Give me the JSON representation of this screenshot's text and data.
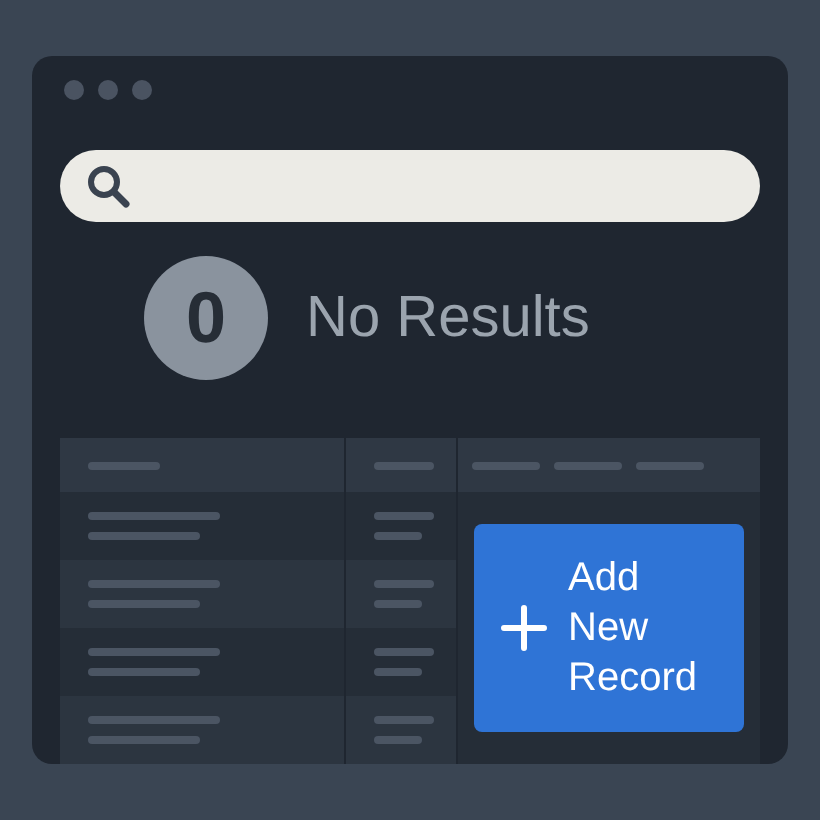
{
  "window": {
    "controls": [
      {
        "kind": "dot"
      },
      {
        "kind": "dot"
      },
      {
        "kind": "dot"
      }
    ]
  },
  "search": {
    "kind": "empty"
  },
  "empty_state": {
    "count": "0",
    "message": "No Results"
  },
  "table": {
    "columns": [
      {
        "kind": "skeleton"
      },
      {
        "kind": "skeleton"
      },
      {
        "kind": "skeleton-group"
      }
    ],
    "rows": [
      {
        "kind": "skeleton"
      },
      {
        "kind": "skeleton"
      },
      {
        "kind": "skeleton"
      },
      {
        "kind": "skeleton"
      }
    ],
    "action": {
      "label": "Add New Record"
    }
  }
}
